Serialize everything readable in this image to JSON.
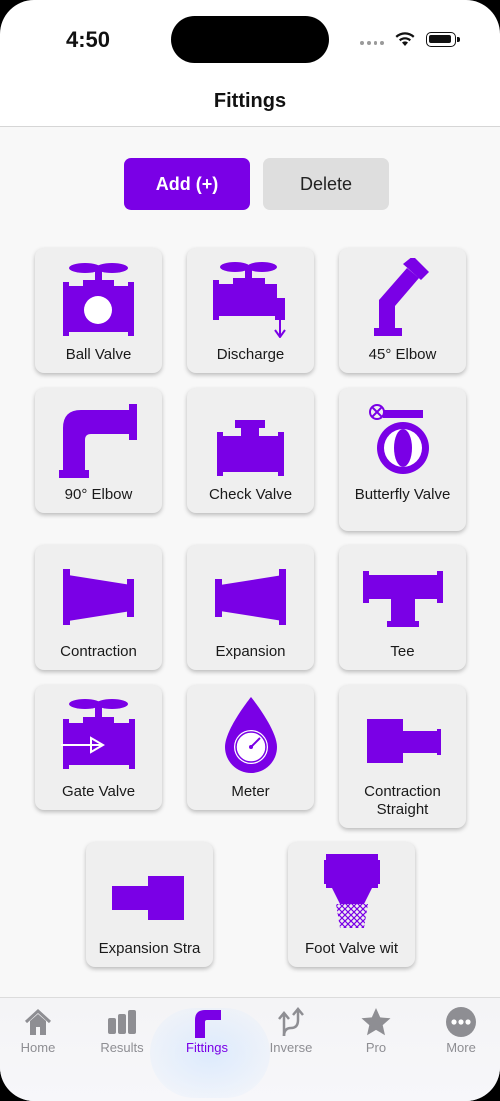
{
  "status": {
    "time": "4:50"
  },
  "nav": {
    "title": "Fittings"
  },
  "actions": {
    "add_label": "Add (+)",
    "delete_label": "Delete"
  },
  "fittings": [
    {
      "label": "Ball Valve",
      "icon": "ball-valve-icon"
    },
    {
      "label": "Discharge",
      "icon": "discharge-icon"
    },
    {
      "label": "45° Elbow",
      "icon": "elbow-45-icon"
    },
    {
      "label": "90° Elbow",
      "icon": "elbow-90-icon"
    },
    {
      "label": "Check Valve",
      "icon": "check-valve-icon"
    },
    {
      "label": "Butterfly Valve",
      "icon": "butterfly-valve-icon"
    },
    {
      "label": "Contraction",
      "icon": "contraction-icon"
    },
    {
      "label": "Expansion",
      "icon": "expansion-icon"
    },
    {
      "label": "Tee",
      "icon": "tee-icon"
    },
    {
      "label": "Gate Valve",
      "icon": "gate-valve-icon"
    },
    {
      "label": "Meter",
      "icon": "meter-icon"
    },
    {
      "label": "Contraction Straight",
      "icon": "contraction-straight-icon"
    },
    {
      "label": "Expansion Stra",
      "icon": "expansion-straight-icon"
    },
    {
      "label": "Foot Valve wit",
      "icon": "foot-valve-icon"
    }
  ],
  "tabs": [
    {
      "label": "Home",
      "icon": "home-icon"
    },
    {
      "label": "Results",
      "icon": "results-icon"
    },
    {
      "label": "Fittings",
      "icon": "fittings-icon",
      "active": true
    },
    {
      "label": "Inverse",
      "icon": "inverse-icon"
    },
    {
      "label": "Pro",
      "icon": "star-icon"
    },
    {
      "label": "More",
      "icon": "more-icon"
    }
  ],
  "colors": {
    "accent": "#7a00e6",
    "inactive": "#8e8e93",
    "card": "#efefef"
  }
}
